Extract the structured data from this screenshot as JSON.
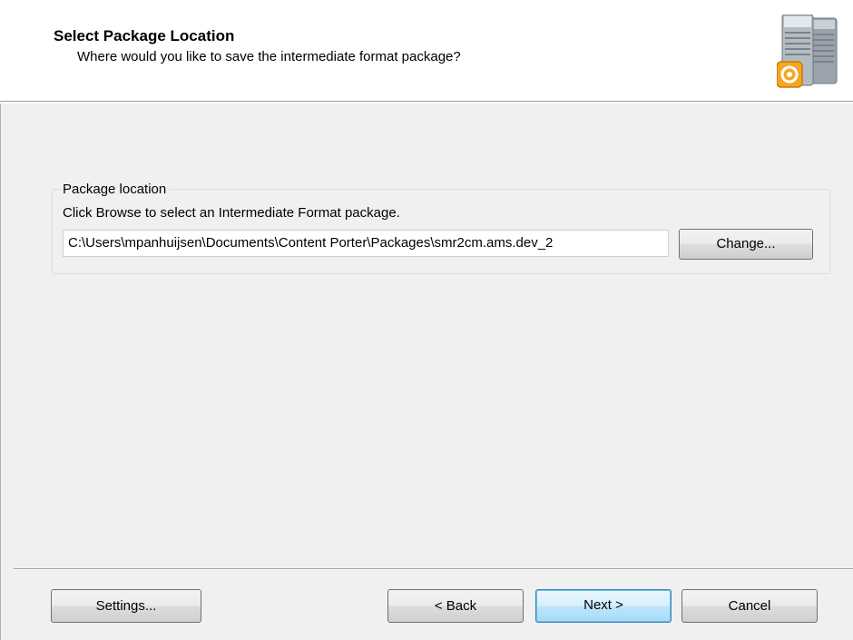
{
  "header": {
    "title": "Select Package Location",
    "subtitle": "Where would you like to save the intermediate format package?",
    "icon": "server-stack-icon"
  },
  "package_location": {
    "legend": "Package location",
    "instruction": "Click Browse to select an Intermediate Format package.",
    "path_value": "C:\\Users\\mpanhuijsen\\Documents\\Content Porter\\Packages\\smr2cm.ams.dev_2",
    "change_label": "Change..."
  },
  "footer": {
    "settings_label": "Settings...",
    "back_label": "< Back",
    "next_label": "Next >",
    "cancel_label": "Cancel"
  },
  "colors": {
    "background": "#f0f0f0",
    "header_background": "#ffffff",
    "default_button_border": "#3c7fb1",
    "icon_accent": "#f5a623"
  }
}
